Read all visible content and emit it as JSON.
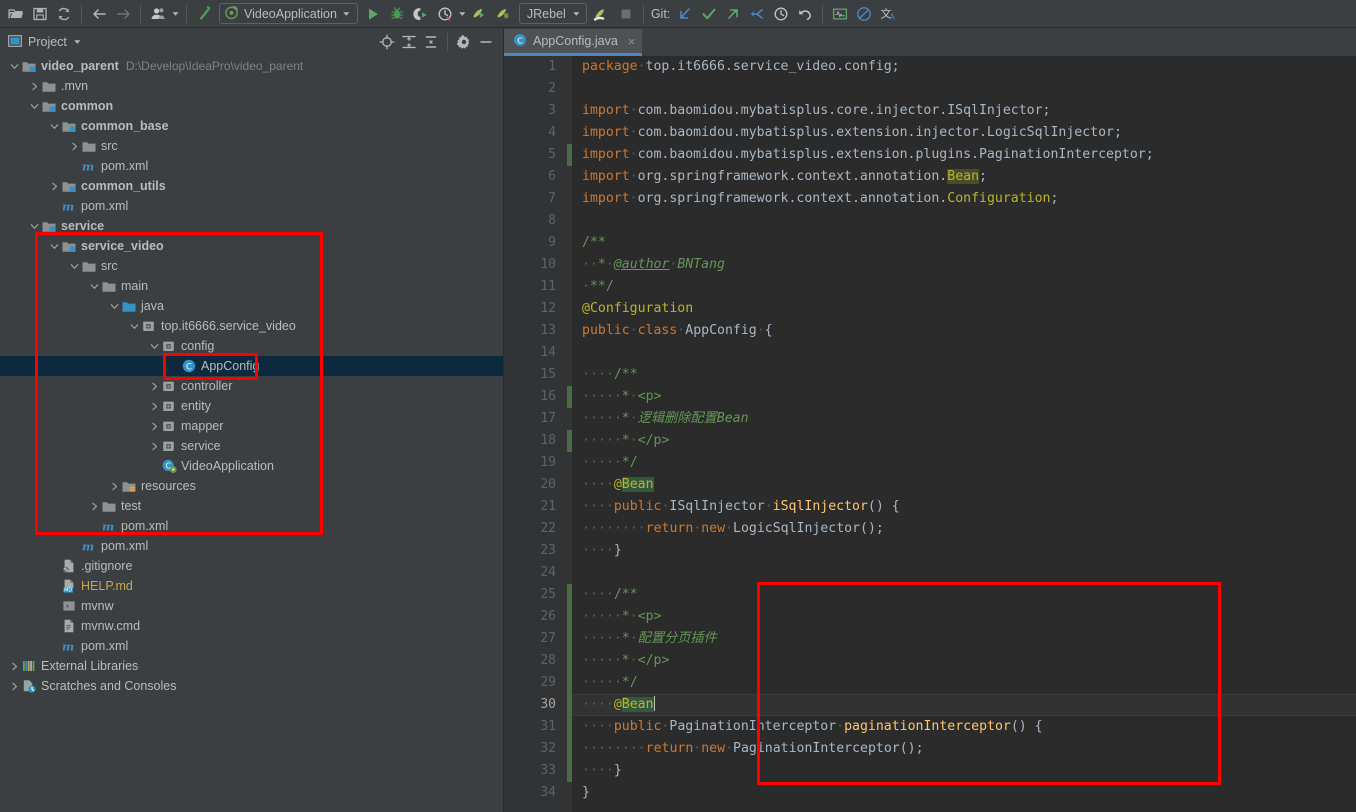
{
  "toolbar": {
    "icons_left": [
      "open-folder-icon",
      "save-all-icon",
      "sync-icon",
      "back-arrow-icon",
      "forward-arrow-icon",
      "profile-icon",
      "update-project-icon"
    ],
    "run_config": {
      "label": "VideoApplication",
      "icon": "spring-boot-icon",
      "caret": "▾"
    },
    "run_icons": [
      "run-icon",
      "debug-icon",
      "run-with-coverage-icon",
      "profiler-icon"
    ],
    "jrebel": {
      "label": "JRebel",
      "caret": "▾"
    },
    "git_label": "Git:",
    "git_icons": [
      "update-project-icon",
      "commit-icon",
      "push-icon",
      "pull-request-icon",
      "history-icon",
      "rollback-icon"
    ],
    "right_icons": [
      "monitor-icon",
      "no-entry-icon",
      "translate-icon"
    ]
  },
  "project_panel": {
    "title": "Project",
    "title_caret": "▾",
    "header_icons": [
      "locate-icon",
      "expand-all-icon",
      "collapse-all-icon",
      "settings-gear-icon",
      "hide-icon"
    ],
    "tree": [
      {
        "depth": 0,
        "arrow": "down",
        "icon": "module-icon",
        "label": "video_parent",
        "bold": true,
        "path": "D:\\Develop\\IdeaPro\\video_parent"
      },
      {
        "depth": 1,
        "arrow": "right",
        "icon": "folder-icon",
        "label": ".mvn"
      },
      {
        "depth": 1,
        "arrow": "down",
        "icon": "module-icon",
        "label": "common",
        "bold": true
      },
      {
        "depth": 2,
        "arrow": "down",
        "icon": "module-icon",
        "label": "common_base",
        "bold": true
      },
      {
        "depth": 3,
        "arrow": "right",
        "icon": "folder-icon",
        "label": "src"
      },
      {
        "depth": 3,
        "arrow": "none",
        "icon": "maven-icon",
        "label": "pom.xml"
      },
      {
        "depth": 2,
        "arrow": "right",
        "icon": "module-icon",
        "label": "common_utils",
        "bold": true
      },
      {
        "depth": 2,
        "arrow": "none",
        "icon": "maven-icon",
        "label": "pom.xml"
      },
      {
        "depth": 1,
        "arrow": "down",
        "icon": "module-icon",
        "label": "service",
        "bold": true
      },
      {
        "depth": 2,
        "arrow": "down",
        "icon": "module-icon",
        "label": "service_video",
        "bold": true
      },
      {
        "depth": 3,
        "arrow": "down",
        "icon": "folder-icon",
        "label": "src"
      },
      {
        "depth": 4,
        "arrow": "down",
        "icon": "folder-icon",
        "label": "main"
      },
      {
        "depth": 5,
        "arrow": "down",
        "icon": "source-root-icon",
        "label": "java"
      },
      {
        "depth": 6,
        "arrow": "down",
        "icon": "package-icon",
        "label": "top.it6666.service_video"
      },
      {
        "depth": 7,
        "arrow": "down",
        "icon": "package-icon",
        "label": "config"
      },
      {
        "depth": 8,
        "arrow": "none",
        "icon": "java-class-icon",
        "label": "AppConfig",
        "selected": true
      },
      {
        "depth": 7,
        "arrow": "right",
        "icon": "package-icon",
        "label": "controller"
      },
      {
        "depth": 7,
        "arrow": "right",
        "icon": "package-icon",
        "label": "entity"
      },
      {
        "depth": 7,
        "arrow": "right",
        "icon": "package-icon",
        "label": "mapper"
      },
      {
        "depth": 7,
        "arrow": "right",
        "icon": "package-icon",
        "label": "service"
      },
      {
        "depth": 7,
        "arrow": "none",
        "icon": "spring-class-icon",
        "label": "VideoApplication"
      },
      {
        "depth": 5,
        "arrow": "right",
        "icon": "resource-root-icon",
        "label": "resources"
      },
      {
        "depth": 4,
        "arrow": "right",
        "icon": "folder-icon",
        "label": "test"
      },
      {
        "depth": 4,
        "arrow": "none",
        "icon": "maven-icon",
        "label": "pom.xml"
      },
      {
        "depth": 3,
        "arrow": "none",
        "icon": "maven-icon",
        "label": "pom.xml"
      },
      {
        "depth": 2,
        "arrow": "none",
        "icon": "gitignore-icon",
        "label": ".gitignore"
      },
      {
        "depth": 2,
        "arrow": "none",
        "icon": "markdown-icon",
        "label": "HELP.md",
        "color": "#c9a64d"
      },
      {
        "depth": 2,
        "arrow": "none",
        "icon": "script-icon",
        "label": "mvnw"
      },
      {
        "depth": 2,
        "arrow": "none",
        "icon": "cmd-icon",
        "label": "mvnw.cmd"
      },
      {
        "depth": 2,
        "arrow": "none",
        "icon": "maven-icon",
        "label": "pom.xml"
      },
      {
        "depth": 0,
        "arrow": "right",
        "icon": "libraries-icon",
        "label": "External Libraries"
      },
      {
        "depth": 0,
        "arrow": "right",
        "icon": "scratches-icon",
        "label": "Scratches and Consoles"
      }
    ]
  },
  "editor": {
    "tab": {
      "label": "AppConfig.java",
      "icon": "java-class-icon",
      "close": "×"
    },
    "current_line": 30,
    "total_lines": 34,
    "lines": [
      {
        "n": 1,
        "text": "package top.it6666.service_video.config;"
      },
      {
        "n": 2,
        "text": ""
      },
      {
        "n": 3,
        "text": "import com.baomidou.mybatisplus.core.injector.ISqlInjector;"
      },
      {
        "n": 4,
        "text": "import com.baomidou.mybatisplus.extension.injector.LogicSqlInjector;"
      },
      {
        "n": 5,
        "text": "import com.baomidou.mybatisplus.extension.plugins.PaginationInterceptor;"
      },
      {
        "n": 6,
        "text": "import org.springframework.context.annotation.Bean;"
      },
      {
        "n": 7,
        "text": "import org.springframework.context.annotation.Configuration;"
      },
      {
        "n": 8,
        "text": ""
      },
      {
        "n": 9,
        "text": "/**"
      },
      {
        "n": 10,
        "text": " * @author BNTang"
      },
      {
        "n": 11,
        "text": " **/"
      },
      {
        "n": 12,
        "text": "@Configuration"
      },
      {
        "n": 13,
        "text": "public class AppConfig {"
      },
      {
        "n": 14,
        "text": ""
      },
      {
        "n": 15,
        "text": "    /**"
      },
      {
        "n": 16,
        "text": "     * <p>"
      },
      {
        "n": 17,
        "text": "     * 逻辑删除配置Bean"
      },
      {
        "n": 18,
        "text": "     * </p>"
      },
      {
        "n": 19,
        "text": "     */"
      },
      {
        "n": 20,
        "text": "    @Bean"
      },
      {
        "n": 21,
        "text": "    public ISqlInjector iSqlInjector() {"
      },
      {
        "n": 22,
        "text": "        return new LogicSqlInjector();"
      },
      {
        "n": 23,
        "text": "    }"
      },
      {
        "n": 24,
        "text": ""
      },
      {
        "n": 25,
        "text": "    /**"
      },
      {
        "n": 26,
        "text": "     * <p>"
      },
      {
        "n": 27,
        "text": "     * 配置分页插件"
      },
      {
        "n": 28,
        "text": "     * </p>"
      },
      {
        "n": 29,
        "text": "     */"
      },
      {
        "n": 30,
        "text": "    @Bean"
      },
      {
        "n": 31,
        "text": "    public PaginationInterceptor paginationInterceptor() {"
      },
      {
        "n": 32,
        "text": "        return new PaginationInterceptor();"
      },
      {
        "n": 33,
        "text": "    }"
      },
      {
        "n": 34,
        "text": "}"
      }
    ]
  },
  "annotations": {
    "color": "#ff0000",
    "boxes": [
      {
        "name": "service-video-module-box"
      },
      {
        "name": "appconfig-node-box"
      },
      {
        "name": "pagination-bean-code-box"
      }
    ]
  },
  "colors": {
    "toolbar_bg": "#3c3f41",
    "editor_bg": "#2b2b2b",
    "gutter_bg": "#313335",
    "selection_bg": "#0d293e",
    "tab_active_underline": "#4a88c7",
    "keyword": "#cc7832",
    "comment": "#629755",
    "annotation": "#bbb529",
    "method": "#ffc66d",
    "text": "#a9b7c6",
    "vcs_changed": "#4a6b46"
  }
}
